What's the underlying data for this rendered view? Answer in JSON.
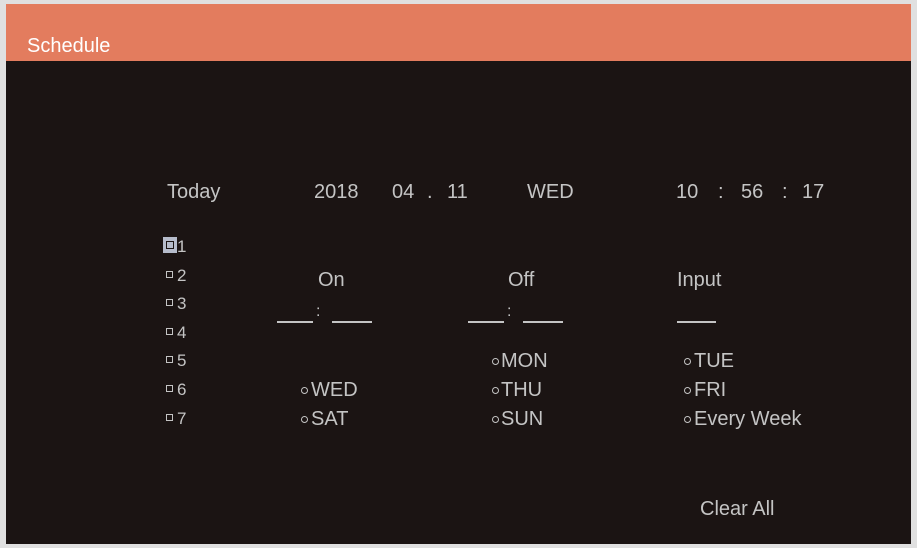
{
  "window": {
    "title": "Schedule"
  },
  "today": {
    "label": "Today",
    "year": "2018",
    "month": "04",
    "date_sep": ".",
    "day": "11",
    "weekday": "WED",
    "hour": "10",
    "time_sep": ":",
    "minute": "56",
    "second": "17"
  },
  "schedules": [
    "1",
    "2",
    "3",
    "4",
    "5",
    "6",
    "7"
  ],
  "selected_schedule": "1",
  "columns": {
    "on": "On",
    "off": "Off",
    "input": "Input"
  },
  "time_sep": ":",
  "days": [
    "MON",
    "TUE",
    "WED",
    "THU",
    "FRI",
    "SAT",
    "SUN",
    "Every Week"
  ],
  "actions": {
    "clear_all": "Clear All"
  },
  "colors": {
    "title_bar": "#e37c5e",
    "background": "#1b1413",
    "text": "#c4c4c4",
    "highlight": "#b6bccb"
  }
}
